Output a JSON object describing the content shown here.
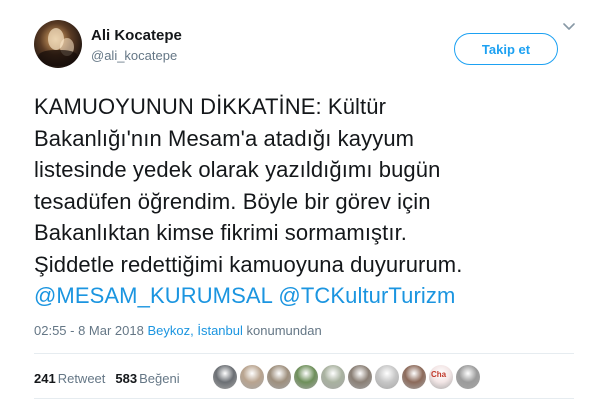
{
  "author": {
    "name": "Ali Kocatepe",
    "handle": "@ali_kocatepe"
  },
  "follow_button": {
    "label": "Takip et"
  },
  "tweet": {
    "lines": [
      "KAMUOYUNUN DİKKATİNE: Kültür",
      "Bakanlığı'nın Mesam'a atadığı kayyum",
      "listesinde yedek olarak yazıldığımı bugün",
      "tesadüfen öğrendim. Böyle bir görev için",
      "Bakanlıktan kimse fikrimi sormamıştır.",
      "Şiddetle redettiğimi kamuoyuna duyururum."
    ],
    "mention1": "@MESAM_KURUMSAL",
    "mention2": "@TCKulturTurizm"
  },
  "meta": {
    "timestamp": "02:55 - 8 Mar 2018",
    "location": "Beykoz, İstanbul",
    "suffix": "konumundan"
  },
  "stats": {
    "retweets": "241",
    "retweets_label": "Retweet",
    "likes": "583",
    "likes_label": "Beğeni"
  },
  "likers": [
    {
      "icon": "liker-avatar",
      "color": "#6b6f74"
    },
    {
      "icon": "liker-avatar",
      "color": "#b9a48f"
    },
    {
      "icon": "liker-avatar",
      "color": "#9e8f7d"
    },
    {
      "icon": "liker-avatar",
      "color": "#6e8f5a"
    },
    {
      "icon": "liker-avatar",
      "color": "#a9b2a0"
    },
    {
      "icon": "liker-avatar",
      "color": "#8a7f75"
    },
    {
      "icon": "liker-avatar",
      "color": "#c7c7c7"
    },
    {
      "icon": "liker-avatar",
      "color": "#8c6a5a"
    },
    {
      "icon": "liker-avatar",
      "color": "#f3e6e6",
      "text": "Cha"
    },
    {
      "icon": "liker-avatar",
      "color": "#9b9b9b"
    }
  ],
  "colors": {
    "accent": "#1da1f2",
    "link": "#1b95e0",
    "muted": "#657786",
    "divider": "#e6ecf0"
  }
}
